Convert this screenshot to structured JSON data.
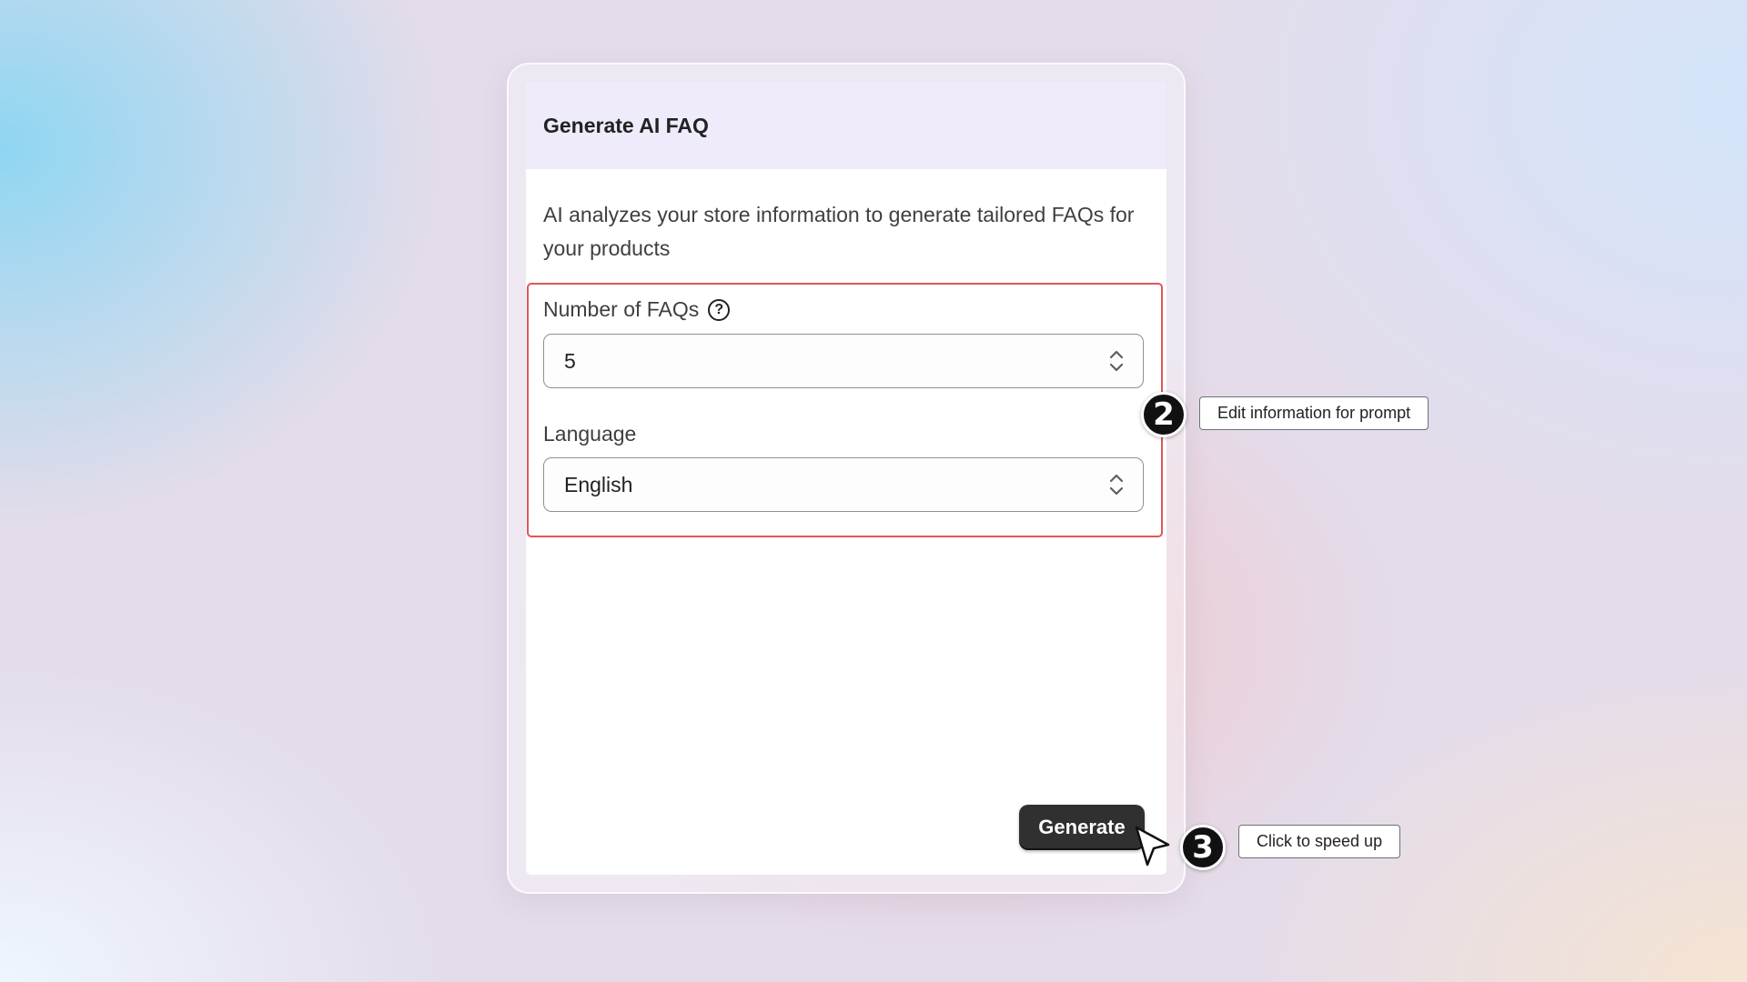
{
  "modal": {
    "title": "Generate AI FAQ",
    "description": "AI analyzes your store information to generate tailored FAQs for your products",
    "faq_count": {
      "label": "Number of FAQs",
      "value": "5",
      "help_icon": "question-circle-icon"
    },
    "language": {
      "label": "Language",
      "value": "English"
    },
    "generate_label": "Generate"
  },
  "annotations": [
    {
      "number": "2",
      "text": "Edit information for prompt"
    },
    {
      "number": "3",
      "text": "Click to speed up"
    }
  ],
  "colors": {
    "highlight_border": "#e0575b",
    "header_bg": "#efebfb",
    "button_bg": "#303030"
  }
}
